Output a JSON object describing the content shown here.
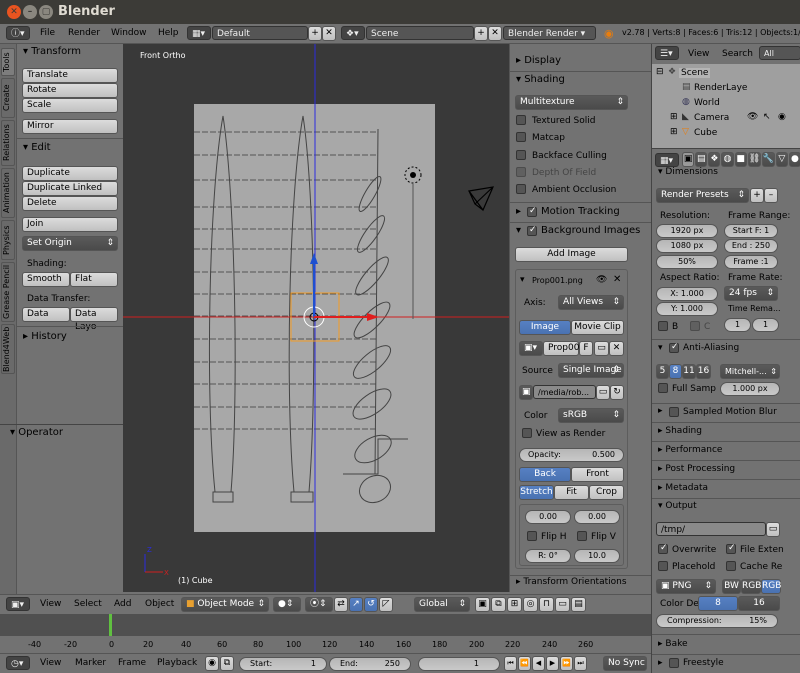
{
  "titlebar": {
    "app": "Blender"
  },
  "info": {
    "menus": [
      "File",
      "Render",
      "Window",
      "Help"
    ],
    "layout": "Default",
    "scene": "Scene",
    "engine": "Blender Render",
    "stats": "v2.78 | Verts:8 | Faces:6 | Tris:12 | Objects:1/"
  },
  "toolshelf": {
    "tabs": [
      "Tools",
      "Create",
      "Relations",
      "Animation",
      "Physics",
      "Grease Pencil",
      "Blend4Web"
    ],
    "transform_header": "Transform",
    "translate": "Translate",
    "rotate": "Rotate",
    "scale": "Scale",
    "mirror": "Mirror",
    "edit_header": "Edit",
    "duplicate": "Duplicate",
    "duplicate_linked": "Duplicate Linked",
    "delete": "Delete",
    "join": "Join",
    "set_origin": "Set Origin",
    "shading_label": "Shading:",
    "smooth": "Smooth",
    "flat": "Flat",
    "data_transfer_label": "Data Transfer:",
    "data": "Data",
    "data_layo": "Data Layo",
    "history_header": "History",
    "operator_header": "Operator"
  },
  "viewport": {
    "view_name": "Front Ortho",
    "object_label": "(1) Cube"
  },
  "npanel": {
    "display": "Display",
    "shading": "Shading",
    "multitexture": "Multitexture",
    "textured_solid": "Textured Solid",
    "matcap": "Matcap",
    "backface": "Backface Culling",
    "depth_of_field": "Depth Of Field",
    "ambient_occlusion": "Ambient Occlusion",
    "motion_tracking": "Motion Tracking",
    "background_images": "Background Images",
    "add_image": "Add Image",
    "prop_file": "Prop001.png",
    "axis_label": "Axis:",
    "axis_value": "All Views",
    "image": "Image",
    "movie_clip": "Movie Clip",
    "prop_short": "Prop00",
    "f": "F",
    "source_label": "Source",
    "source_value": "Single Image",
    "path": "/media/rob...",
    "color_label": "Color",
    "color_value": "sRGB",
    "view_as_render": "View as Render",
    "opacity": "Opacity:",
    "opacity_value": "0.500",
    "back": "Back",
    "front": "Front",
    "stretch": "Stretch",
    "fit": "Fit",
    "crop": "Crop",
    "x_offset": "0.00",
    "y_offset": "0.00",
    "flip_h": "Flip H",
    "flip_v": "Flip V",
    "rotation": "R: 0°",
    "size": "10.0",
    "transform_orientations": "Transform Orientations"
  },
  "outliner": {
    "view": "View",
    "search": "Search",
    "all_scenes": "All Scene",
    "items": [
      "Scene",
      "RenderLaye",
      "World",
      "Camera",
      "Cube"
    ]
  },
  "properties": {
    "dimensions": "Dimensions",
    "render_presets": "Render Presets",
    "resolution_label": "Resolution:",
    "res_x": "1920 px",
    "res_y": "1080 px",
    "res_pct": "50%",
    "frame_range_label": "Frame Range:",
    "start": "Start F: 1",
    "end": "End : 250",
    "step": "Frame :1",
    "aspect_label": "Aspect Ratio:",
    "asp_x": "X: 1.000",
    "asp_y": "Y: 1.000",
    "frame_rate_label": "Frame Rate:",
    "fps": "24 fps",
    "time_remap": "Time Rema...",
    "remap_old": "1",
    "remap_new": "1",
    "b": "B",
    "c": "C",
    "anti_aliasing": "Anti-Aliasing",
    "aa_samples": [
      "5",
      "8",
      "11",
      "16"
    ],
    "aa_filter": "Mitchell-...",
    "full_sample": "Full Samp",
    "aa_size": "1.000 px",
    "sampled_motion_blur": "Sampled Motion Blur",
    "shading": "Shading",
    "performance": "Performance",
    "post_processing": "Post Processing",
    "metadata": "Metadata",
    "output": "Output",
    "output_path": "/tmp/",
    "overwrite": "Overwrite",
    "file_ext": "File Exten",
    "placeholder": "Placehold",
    "cache": "Cache Re",
    "format": "PNG",
    "bw": "BW",
    "rgb": "RGB",
    "rgba": "RGB",
    "color_depth_label": "Color De",
    "depth8": "8",
    "depth16": "16",
    "compression": "Compression:",
    "compression_value": "15%",
    "bake": "Bake",
    "freestyle": "Freestyle"
  },
  "view3d_header": {
    "view": "View",
    "select": "Select",
    "add": "Add",
    "object": "Object",
    "mode": "Object Mode",
    "orientation": "Global"
  },
  "timeline": {
    "ticks": [
      "-40",
      "-20",
      "0",
      "20",
      "40",
      "60",
      "80",
      "100",
      "120",
      "140",
      "160",
      "180",
      "200",
      "220",
      "240",
      "260"
    ],
    "current_frame": 1,
    "view": "View",
    "marker": "Marker",
    "frame": "Frame",
    "playback": "Playback",
    "start_label": "Start:",
    "start_value": "1",
    "end_label": "End:",
    "end_value": "250",
    "frame_value": "1",
    "sync": "No Sync"
  }
}
